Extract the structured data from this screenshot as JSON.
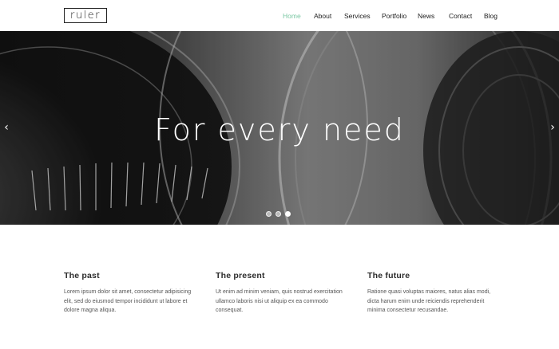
{
  "brand": {
    "logo_text": "ruler"
  },
  "nav": {
    "items": [
      {
        "label": "Home",
        "active": true
      },
      {
        "label": "About",
        "active": false
      },
      {
        "label": "Services",
        "active": false
      },
      {
        "label": "Portfolio",
        "active": false
      },
      {
        "label": "News",
        "active": false
      },
      {
        "label": "Contact",
        "active": false
      },
      {
        "label": "Blog",
        "active": false
      }
    ]
  },
  "hero": {
    "title": "For every need",
    "prev_icon": "chevron-left-icon",
    "next_icon": "chevron-right-icon",
    "prev_glyph": "‹",
    "next_glyph": "›",
    "slides_total": 3,
    "active_slide": 3
  },
  "columns": [
    {
      "heading": "The past",
      "text": "Lorem ipsum dolor sit amet, consectetur adipisicing elit, sed do eiusmod tempor incididunt ut labore et dolore magna aliqua."
    },
    {
      "heading": "The present",
      "text": "Ut enim ad minim veniam, quis nostrud exercitation ullamco laboris nisi ut aliquip ex ea commodo consequat."
    },
    {
      "heading": "The future",
      "text": "Ratione quasi voluptas maiores, natus alias modi, dicta harum enim unde reiciendis reprehenderit minima consectetur recusandae."
    }
  ],
  "colors": {
    "accent": "#7cc8a4",
    "text": "#222222"
  }
}
